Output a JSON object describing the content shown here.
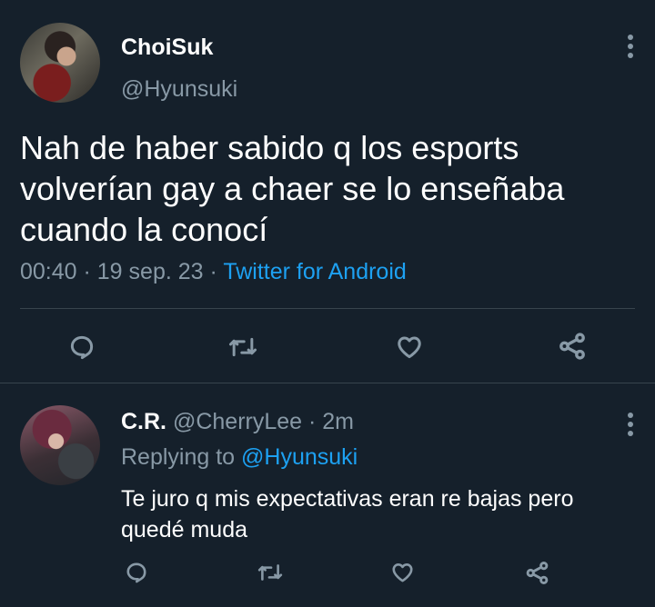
{
  "tweet": {
    "author_name": "ChoiSuk",
    "author_handle": "@Hyunsuki",
    "text": "Nah de haber sabido q los esports volverían gay a chaer se lo enseñaba cuando la conocí",
    "time": "00:40",
    "sep1": " · ",
    "date": "19 sep. 23",
    "sep2": " · ",
    "source": "Twitter for Android"
  },
  "reply": {
    "author_name": "C.R.",
    "author_handle": "@CherryLee",
    "sep": " · ",
    "age": "2m",
    "replying_prefix": "Replying to ",
    "replying_handle": "@Hyunsuki",
    "text": "Te juro q mis expectativas eran re bajas pero quedé muda"
  },
  "icons": {
    "more": "more-vertical-icon",
    "reply": "reply-bubble-icon",
    "retweet": "retweet-icon",
    "like": "heart-icon",
    "share": "share-icon"
  },
  "colors": {
    "background": "#15202b",
    "text": "#ffffff",
    "secondary": "#8899a6",
    "link": "#1da1f2",
    "divider": "#38444d"
  }
}
